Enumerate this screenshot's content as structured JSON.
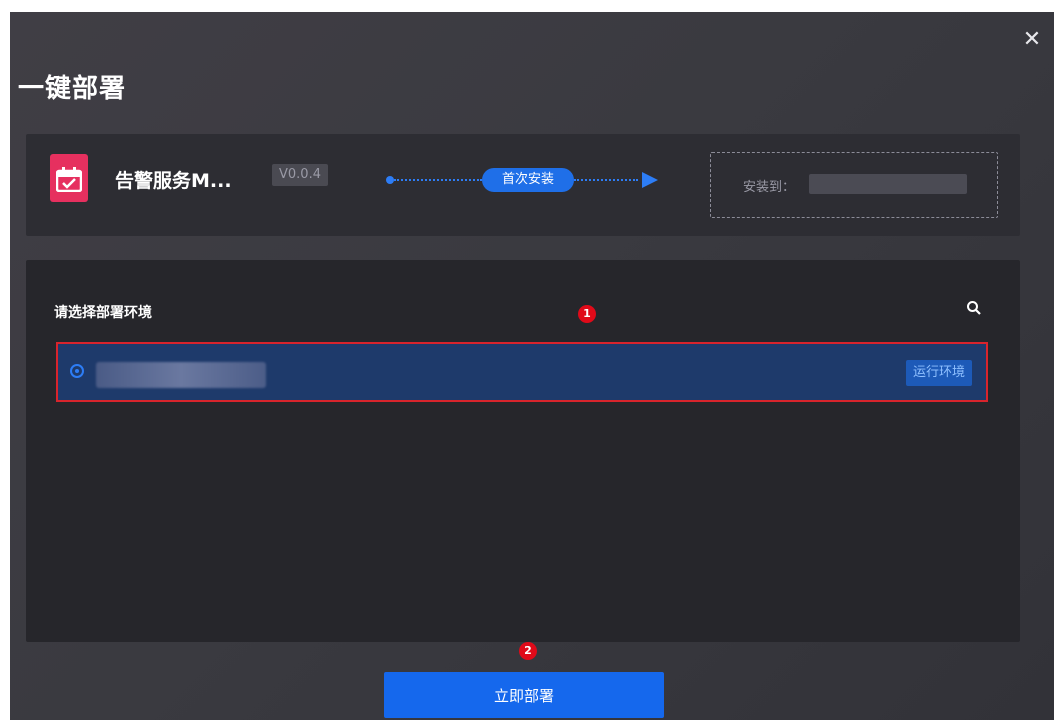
{
  "dialog": {
    "title": "一键部署",
    "close_icon": "close-icon"
  },
  "app": {
    "icon": "calendar-check-icon",
    "icon_color": "#e6305f",
    "name": "告警服务M...",
    "version": "V0.0.4",
    "flow_label": "首次安装",
    "install_to_label": "安装到："
  },
  "env": {
    "section_label": "请选择部署环境",
    "search_icon": "search-icon",
    "items": [
      {
        "selected": true,
        "tag": "运行环境"
      }
    ]
  },
  "annotations": {
    "badge_1": "1",
    "badge_2": "2",
    "color": "#e00a19"
  },
  "footer": {
    "deploy_label": "立即部署"
  },
  "colors": {
    "accent": "#1568ed",
    "selected_row": "#1e3a6b",
    "highlight_border": "#d8242c"
  }
}
